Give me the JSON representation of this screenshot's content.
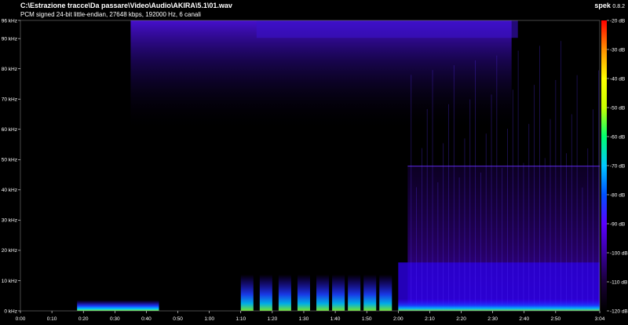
{
  "header": {
    "file_path": "C:\\Estrazione tracce\\Da passare\\Video\\Audio\\AKIRA\\5.1\\01.wav",
    "stream_info": "PCM signed 24-bit little-endian, 27648 kbps, 192000 Hz, 6 canali"
  },
  "brand": {
    "name": "spek",
    "version": "0.8.2"
  },
  "chart_data": {
    "type": "heatmap",
    "title": "",
    "x_axis": {
      "ticks": [
        "0:00",
        "0:10",
        "0:20",
        "0:30",
        "0:40",
        "0:50",
        "1:00",
        "1:10",
        "1:20",
        "1:30",
        "1:40",
        "1:50",
        "2:00",
        "2:10",
        "2:20",
        "2:30",
        "2:40",
        "2:50",
        "3:04"
      ],
      "tick_values_s": [
        0,
        10,
        20,
        30,
        40,
        50,
        60,
        70,
        80,
        90,
        100,
        110,
        120,
        130,
        140,
        150,
        160,
        170
      ],
      "range_s": [
        0,
        184
      ]
    },
    "y_axis": {
      "ticks": [
        "0 kHz",
        "10 kHz",
        "20 kHz",
        "30 kHz",
        "40 kHz",
        "50 kHz",
        "60 kHz",
        "70 kHz",
        "80 kHz",
        "90 kHz",
        "96 kHz"
      ],
      "tick_values_khz": [
        0,
        10,
        20,
        30,
        40,
        50,
        60,
        70,
        80,
        90,
        96
      ],
      "range_khz": [
        0,
        96
      ]
    },
    "color_scale": {
      "ticks": [
        "-20 dB",
        "-30 dB",
        "-40 dB",
        "-50 dB",
        "-60 dB",
        "-70 dB",
        "-80 dB",
        "-90 dB",
        "-100 dB",
        "-110 dB",
        "-120 dB"
      ],
      "tick_values_db": [
        -20,
        -30,
        -40,
        -50,
        -60,
        -70,
        -80,
        -90,
        -100,
        -110,
        -120
      ],
      "range_db": [
        -120,
        -20
      ],
      "colors": [
        "#000000",
        "#1a0038",
        "#3a00a0",
        "#5a00ff",
        "#0050ff",
        "#00c8ff",
        "#00ff70",
        "#c8ff00",
        "#ffff00",
        "#ff9000",
        "#ff0000"
      ]
    }
  }
}
